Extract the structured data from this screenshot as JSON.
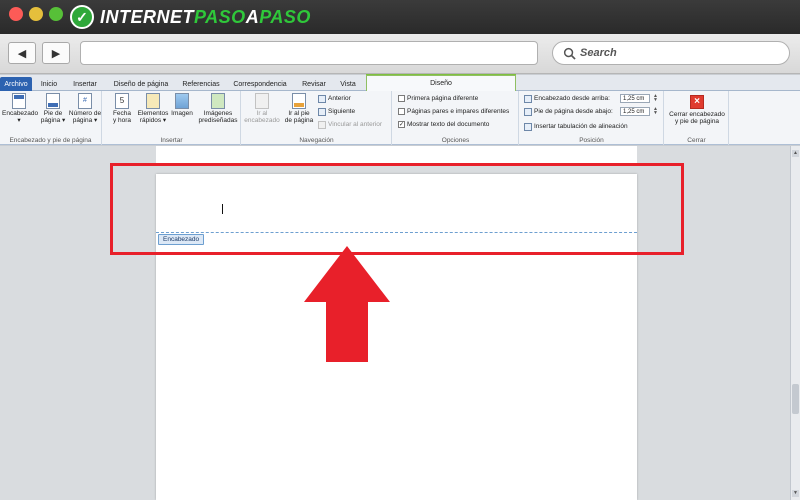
{
  "brand": {
    "prefix": "INTERNET",
    "accent": "PASO",
    "middle": "A",
    "suffix": "PASO",
    "color": "#2fc83a"
  },
  "browser": {
    "back_glyph": "◀",
    "forward_glyph": "▶",
    "url": "",
    "search_placeholder": "Search"
  },
  "ribbon_tabs": [
    "Archivo",
    "Inicio",
    "Insertar",
    "Diseño de página",
    "Referencias",
    "Correspondencia",
    "Revisar",
    "Vista",
    "Diseño"
  ],
  "groups": {
    "encabezado": {
      "label": "Encabezado y pie de página",
      "items": [
        {
          "line1": "Encabezado",
          "line2": "▾"
        },
        {
          "line1": "Pie de",
          "line2": "página ▾"
        },
        {
          "line1": "Número de",
          "line2": "página ▾"
        }
      ]
    },
    "insertar": {
      "label": "Insertar",
      "items": [
        {
          "line1": "Fecha",
          "line2": "y hora"
        },
        {
          "line1": "Elementos",
          "line2": "rápidos ▾"
        },
        {
          "line1": "Imagen",
          "line2": ""
        },
        {
          "line1": "Imágenes",
          "line2": "prediseñadas"
        }
      ]
    },
    "navegacion": {
      "label": "Navegación",
      "items": [
        {
          "line1": "Ir al",
          "line2": "encabezado"
        },
        {
          "line1": "Ir al pie",
          "line2": "de página"
        }
      ],
      "small": [
        "Anterior",
        "Siguiente",
        "Vincular al anterior"
      ]
    },
    "opciones": {
      "label": "Opciones",
      "checks": [
        {
          "label": "Primera página diferente",
          "checked": false
        },
        {
          "label": "Páginas pares e impares diferentes",
          "checked": false
        },
        {
          "label": "Mostrar texto del documento",
          "checked": true
        }
      ]
    },
    "posicion": {
      "label": "Posición",
      "rows": [
        {
          "label": "Encabezado desde arriba:",
          "value": "1,25 cm"
        },
        {
          "label": "Pie de página desde abajo:",
          "value": "1,25 cm"
        }
      ],
      "insert_tab": "Insertar tabulación de alineación"
    },
    "cerrar": {
      "label": "Cerrar",
      "button_line1": "Cerrar encabezado",
      "button_line2": "y pie de página"
    }
  },
  "document": {
    "header_tag": "Encabezado"
  },
  "colors": {
    "highlight": "#e8202a",
    "ribbon_accent": "#7fbf3f",
    "file_tab": "#2c62b0"
  }
}
